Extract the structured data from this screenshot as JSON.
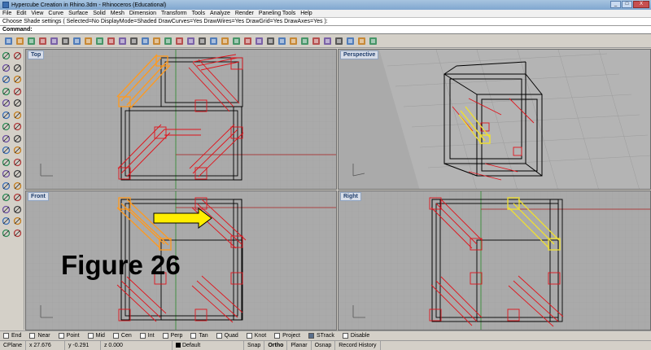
{
  "window": {
    "title": "Hypercube Creation in Rhino.3dm - Rhinoceros (Educational)",
    "buttons": [
      "_",
      "□",
      "X"
    ]
  },
  "menu": [
    "File",
    "Edit",
    "View",
    "Curve",
    "Surface",
    "Solid",
    "Mesh",
    "Dimension",
    "Transform",
    "Tools",
    "Analyze",
    "Render",
    "Paneling Tools",
    "Help"
  ],
  "command_history": "Choose Shade settings ( Selected=No DisplayMode=Shaded DrawCurves=Yes DrawWires=Yes DrawGrid=Yes DrawAxes=Yes ):",
  "command_prompt": "Command:",
  "toolbar_icons": [
    "new-icon",
    "open-icon",
    "save-icon",
    "print-icon",
    "import-icon",
    "cut-icon",
    "copy-icon",
    "paste-icon",
    "undo-icon",
    "redo-icon",
    "pan-icon",
    "rotate-view-icon",
    "zoom-icon",
    "zoom-window-icon",
    "zoom-extents-icon",
    "zoom-selected-icon",
    "viewport-grid-icon",
    "cplane-icon",
    "layer-icon",
    "wireframe-icon",
    "shaded-icon",
    "rendered-icon",
    "material-icon",
    "light-icon",
    "snap-icon",
    "gumball-icon",
    "dimension-icon",
    "help-icon",
    "grip-icon",
    "render-icon",
    "render-preview-icon",
    "environment-icon",
    "texture-icon"
  ],
  "sidebar_icons": [
    "select-icon",
    "point-icon",
    "polyline-icon",
    "curve-icon",
    "circle-icon",
    "arc-icon",
    "ellipse-icon",
    "rectangle-icon",
    "polygon-icon",
    "text-icon",
    "surface-icon",
    "extrude-icon",
    "solid-box-icon",
    "sphere-icon",
    "mesh-icon",
    "boolean-icon",
    "fillet-icon",
    "trim-icon",
    "split-icon",
    "join-icon",
    "explode-icon",
    "move-icon",
    "copy-obj-icon",
    "rotate-icon",
    "scale-icon",
    "mirror-icon",
    "array-icon",
    "group-icon",
    "analyze-icon",
    "dimension-tool-icon",
    "render-tool-icon",
    "properties-icon"
  ],
  "viewports": {
    "top": "Top",
    "perspective": "Perspective",
    "front": "Front",
    "right": "Right"
  },
  "figure_label": "Figure 26",
  "colors": {
    "selected": "#ff9a1f",
    "selected_right": "#f0e030",
    "geometry_red": "#e0141c",
    "arrow": "#ffee00",
    "viewport_bg": "#aaaaaa"
  },
  "osnaps": [
    {
      "label": "End",
      "checked": false
    },
    {
      "label": "Near",
      "checked": false
    },
    {
      "label": "Point",
      "checked": false
    },
    {
      "label": "Mid",
      "checked": false
    },
    {
      "label": "Cen",
      "checked": false
    },
    {
      "label": "Int",
      "checked": false
    },
    {
      "label": "Perp",
      "checked": false
    },
    {
      "label": "Tan",
      "checked": false
    },
    {
      "label": "Quad",
      "checked": false
    },
    {
      "label": "Knot",
      "checked": false
    },
    {
      "label": "Project",
      "checked": false
    },
    {
      "label": "STrack",
      "checked": true
    },
    {
      "label": "Disable",
      "checked": false
    }
  ],
  "status": {
    "cplane": "CPlane",
    "x": "x 27.676",
    "y": "y -0.291",
    "z": "z 0.000",
    "layer": "Default",
    "snap": "Snap",
    "ortho": "Ortho",
    "planar": "Planar",
    "osnap": "Osnap",
    "record_history": "Record History"
  }
}
